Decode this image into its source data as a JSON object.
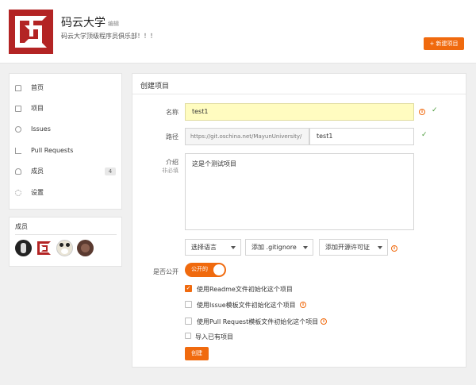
{
  "header": {
    "org_name": "码云大学",
    "edit_label": "编辑",
    "org_desc": "码云大学顶级程序员俱乐部！！！",
    "new_project_label": "+ 新建项目"
  },
  "sidebar": {
    "items": [
      {
        "label": "首页",
        "icon": "home-icon"
      },
      {
        "label": "项目",
        "icon": "project-icon"
      },
      {
        "label": "Issues",
        "icon": "issue-icon"
      },
      {
        "label": "Pull Requests",
        "icon": "pull-request-icon"
      },
      {
        "label": "成员",
        "icon": "members-icon",
        "badge": "4"
      },
      {
        "label": "设置",
        "icon": "settings-icon"
      }
    ],
    "members_title": "成员"
  },
  "form": {
    "title": "创建项目",
    "name_label": "名称",
    "name_value": "test1",
    "path_label": "路径",
    "path_prefix": "https://git.oschina.net/MayunUniversity/",
    "path_value": "test1",
    "desc_label": "介绍",
    "desc_sublabel": "非必填",
    "desc_value": "这是个测试项目",
    "select_language": "选择语言",
    "select_gitignore": "添加 .gitignore",
    "select_license": "添加开源许可证",
    "public_label": "是否公开",
    "public_toggle_label": "公开的",
    "cb_readme": "使用Readme文件初始化这个项目",
    "cb_issue": "使用Issue模板文件初始化这个项目",
    "cb_pr": "使用Pull Request模板文件初始化这个项目",
    "import_existing": "导入已有项目",
    "create_label": "创建"
  },
  "colors": {
    "accent": "#f06a0e",
    "logo_red": "#b32424",
    "highlight_input": "#fffcc0",
    "success_check": "#4a9a3a"
  }
}
